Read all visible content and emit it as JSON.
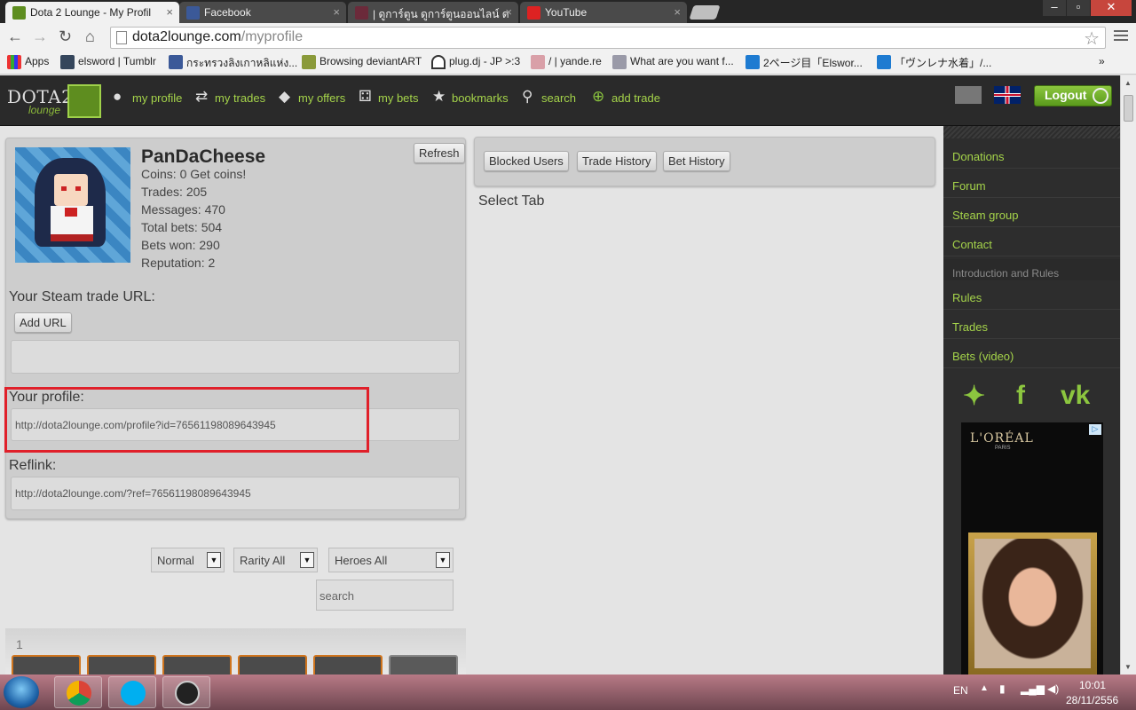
{
  "browser": {
    "tabs": [
      {
        "title": "Dota 2 Lounge - My Profil",
        "active": true
      },
      {
        "title": "Facebook",
        "active": false
      },
      {
        "title": "| ดูการ์ตูน ดูการ์ตูนออนไลน์ ด",
        "active": false
      },
      {
        "title": "YouTube",
        "active": false
      }
    ],
    "address_host": "dota2lounge.com",
    "address_path": "/myprofile",
    "bookmarks": [
      "Apps",
      "elsword | Tumblr",
      "กระทรวงลิงเกาหลิแห่ง...",
      "Browsing deviantART",
      "plug.dj - JP >:3",
      "/ | yande.re",
      "What are you want f...",
      "2ページ目「Elswor...",
      "「ヴンレナ水着」/..."
    ]
  },
  "site": {
    "logo_text": "DOTA2",
    "logo_sub": "lounge",
    "nav": [
      {
        "label": "my profile",
        "icon": "person-icon"
      },
      {
        "label": "my trades",
        "icon": "trades-icon"
      },
      {
        "label": "my offers",
        "icon": "tag-icon"
      },
      {
        "label": "my bets",
        "icon": "dice-icon"
      },
      {
        "label": "bookmarks",
        "icon": "star-icon"
      },
      {
        "label": "search",
        "icon": "magnifier-icon"
      },
      {
        "label": "add trade",
        "icon": "plus-circle-icon"
      }
    ],
    "logout_label": "Logout"
  },
  "profile": {
    "username": "PanDaCheese",
    "refresh_label": "Refresh",
    "coins": "Coins: 0",
    "get_coins": "Get coins!",
    "trades": "Trades: 205",
    "messages": "Messages: 470",
    "total_bets": "Total bets: 504",
    "bets_won": "Bets won: 290",
    "reputation": "Reputation: 2",
    "steam_trade_label": "Your Steam trade URL:",
    "add_url_label": "Add URL",
    "steam_trade_value": "",
    "your_profile_label": "Your profile:",
    "your_profile_url": "http://dota2lounge.com/profile?id=76561198089643945",
    "reflink_label": "Reflink:",
    "reflink_url": "http://dota2lounge.com/?ref=76561198089643945"
  },
  "tabs_panel": {
    "buttons": [
      "Blocked Users",
      "Trade History",
      "Bet History"
    ],
    "placeholder": "Select Tab"
  },
  "filters": {
    "quality": "Normal",
    "rarity": "Rarity All",
    "heroes": "Heroes All",
    "search_placeholder": "search",
    "page": "1"
  },
  "sidebar": {
    "links1": [
      "Donations",
      "Forum",
      "Steam group",
      "Contact"
    ],
    "header": "Introduction and Rules",
    "links2": [
      "Rules",
      "Trades",
      "Bets (video)"
    ],
    "social": [
      "twitter-icon",
      "facebook-icon",
      "vk-icon"
    ],
    "ad_brand": "L'ORÉAL",
    "ad_sub": "PARIS"
  },
  "taskbar": {
    "lang": "EN",
    "time": "10:01",
    "date": "28/11/2556"
  }
}
